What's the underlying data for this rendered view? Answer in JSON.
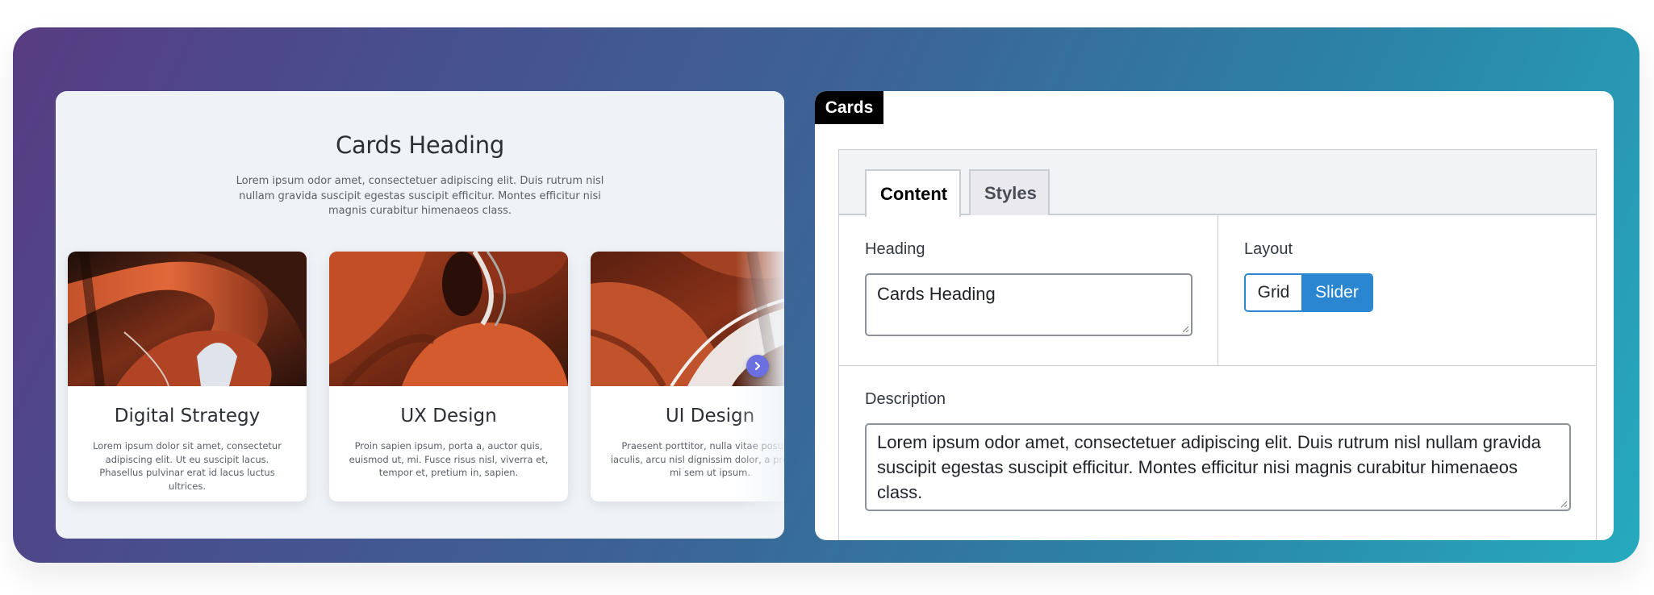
{
  "preview": {
    "heading": "Cards Heading",
    "description": "Lorem ipsum odor amet, consectetuer adipiscing elit. Duis rutrum nisl nullam gravida suscipit egestas suscipit efficitur. Montes efficitur nisi magnis curabitur himenaeos class.",
    "cards": [
      {
        "title": "Digital Strategy",
        "text": "Lorem ipsum dolor sit amet, consectetur adipiscing elit. Ut eu suscipit lacus. Phasellus pulvinar erat id lacus luctus ultrices."
      },
      {
        "title": "UX Design",
        "text": "Proin sapien ipsum, porta a, auctor quis, euismod ut, mi. Fusce risus nisl, viverra et, tempor et, pretium in, sapien."
      },
      {
        "title": "UI Design",
        "text": "Praesent porttitor, nulla vitae posuere iaculis, arcu nisl dignissim dolor, a pretium mi sem ut ipsum."
      }
    ],
    "next_icon": "chevron-right-icon"
  },
  "editor": {
    "block_label": "Cards",
    "tabs": [
      "Content",
      "Styles"
    ],
    "active_tab": "Content",
    "heading_label": "Heading",
    "heading_value": "Cards Heading",
    "layout_label": "Layout",
    "layout_options": [
      "Grid",
      "Slider"
    ],
    "layout_selected": "Slider",
    "description_label": "Description",
    "description_value": "Lorem ipsum odor amet, consectetuer adipiscing elit. Duis rutrum nisl nullam gravida suscipit egestas suscipit efficitur. Montes efficitur nisi magnis curabitur himenaeos class."
  },
  "colors": {
    "accent": "#2b86d1",
    "slider_arrow": "#6c6fe0",
    "gradient_start": "#583c82",
    "gradient_end": "#26aabe"
  }
}
